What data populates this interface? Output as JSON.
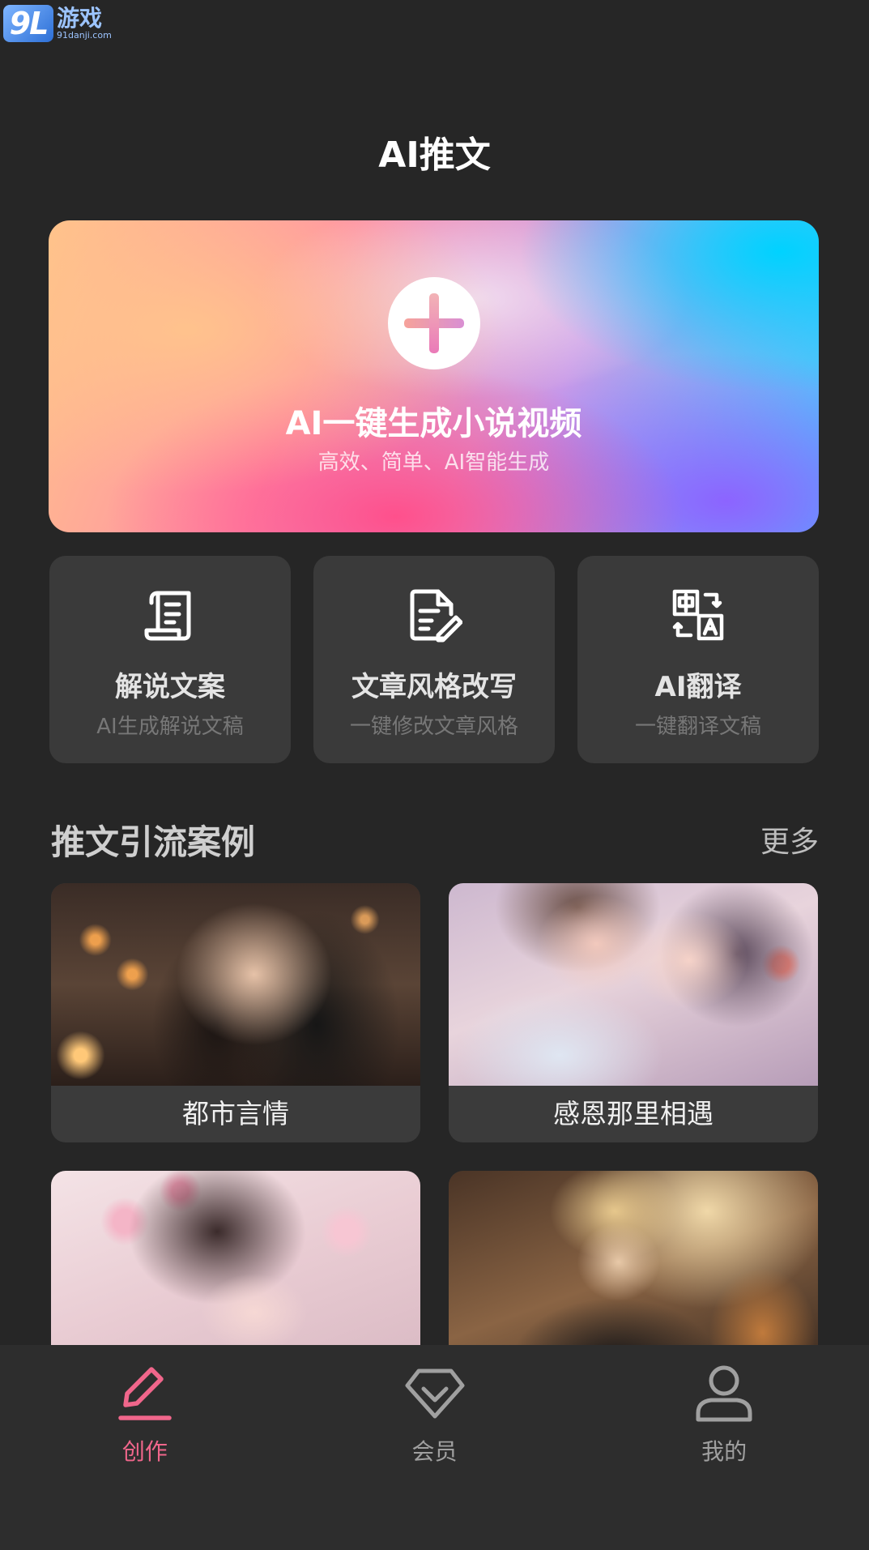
{
  "watermark": {
    "logo": "9L",
    "main": "游戏",
    "sub": "91danji.com"
  },
  "header": {
    "title": "AI推文"
  },
  "hero": {
    "title": "AI一键生成小说视频",
    "subtitle": "高效、简单、AI智能生成",
    "icon": "plus-icon"
  },
  "tools": [
    {
      "name": "解说文案",
      "desc": "AI生成解说文稿",
      "icon": "script-scroll-icon"
    },
    {
      "name": "文章风格改写",
      "desc": "一键修改文章风格",
      "icon": "document-edit-icon"
    },
    {
      "name": "AI翻译",
      "desc": "一键翻译文稿",
      "icon": "translate-icon"
    }
  ],
  "section": {
    "title": "推文引流案例",
    "more": "更多"
  },
  "cases": [
    {
      "label": "都市言情"
    },
    {
      "label": "感恩那里相遇"
    },
    {
      "label": ""
    },
    {
      "label": ""
    }
  ],
  "tabbar": {
    "active_color": "#f0668b",
    "items": [
      {
        "label": "创作",
        "icon": "pen-icon",
        "active": true
      },
      {
        "label": "会员",
        "icon": "diamond-icon",
        "active": false
      },
      {
        "label": "我的",
        "icon": "user-icon",
        "active": false
      }
    ]
  }
}
